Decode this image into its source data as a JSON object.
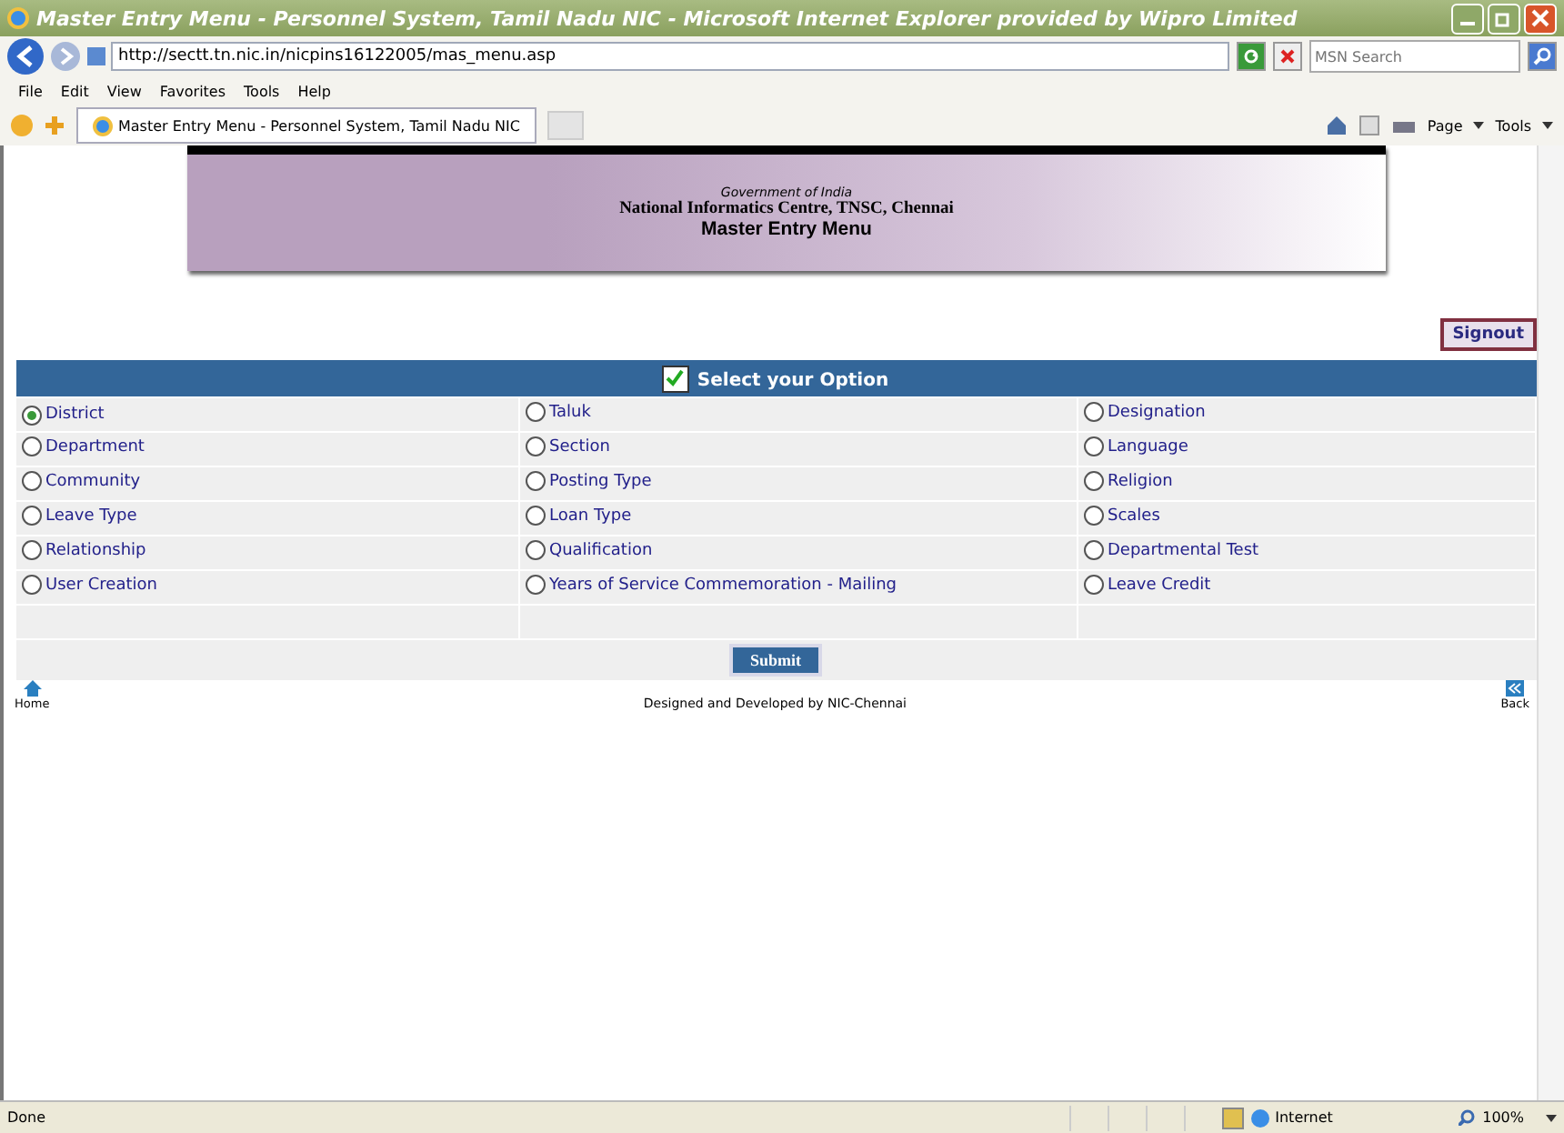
{
  "window": {
    "title": "Master Entry Menu - Personnel System, Tamil Nadu NIC - Microsoft Internet Explorer provided by Wipro Limited"
  },
  "address": "http://sectt.tn.nic.in/nicpins16122005/mas_menu.asp",
  "search": {
    "placeholder": "MSN Search"
  },
  "menu": [
    "File",
    "Edit",
    "View",
    "Favorites",
    "Tools",
    "Help"
  ],
  "tab": {
    "title": "Master Entry Menu - Personnel System, Tamil Nadu NIC"
  },
  "command_bar": [
    "Page",
    "Tools"
  ],
  "banner": {
    "line_1": "Government of India",
    "line_2": "National Informatics Centre, TNSC, Chennai",
    "title": "Master Entry Menu"
  },
  "signout": "Signout",
  "options_header": "Select your Option",
  "options": [
    {
      "label": "District",
      "selected": true
    },
    {
      "label": "Taluk",
      "selected": false
    },
    {
      "label": "Designation",
      "selected": false
    },
    {
      "label": "Department",
      "selected": false
    },
    {
      "label": "Section",
      "selected": false
    },
    {
      "label": "Language",
      "selected": false
    },
    {
      "label": "Community",
      "selected": false
    },
    {
      "label": "Posting Type",
      "selected": false
    },
    {
      "label": "Religion",
      "selected": false
    },
    {
      "label": "Leave Type",
      "selected": false
    },
    {
      "label": "Loan Type",
      "selected": false
    },
    {
      "label": "Scales",
      "selected": false
    },
    {
      "label": "Relationship",
      "selected": false
    },
    {
      "label": "Qualification",
      "selected": false
    },
    {
      "label": "Departmental Test",
      "selected": false
    },
    {
      "label": "User Creation",
      "selected": false
    },
    {
      "label": "Years of Service Commemoration - Mailing",
      "selected": false
    },
    {
      "label": "Leave Credit",
      "selected": false
    }
  ],
  "submit": "Submit",
  "footer": {
    "home": "Home",
    "credit": "Designed and Developed by NIC-Chennai",
    "back": "Back"
  },
  "status_bar": {
    "status": "Done",
    "zone": "Internet",
    "zoom": "100%"
  }
}
